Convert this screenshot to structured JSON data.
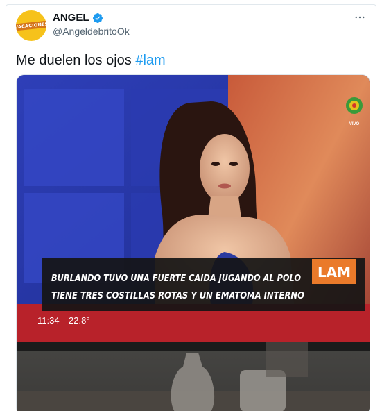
{
  "tweet": {
    "author": {
      "display_name": "ANGEL",
      "handle": "@AngeldebritoOk",
      "avatar_text": "VACACIONES"
    },
    "text_prefix": "Me duelen los ojos ",
    "hashtag": "#lam",
    "media": {
      "channel_logo_text": "VIVO",
      "show_logo": "LAM",
      "headline_line1": "BURLANDO TUVO UNA FUERTE CAIDA JUGANDO AL POLO",
      "headline_line2": "TIENE TRES COSTILLAS ROTAS Y UN EMATOMA INTERNO",
      "clock": "11:34",
      "temperature": "22.8°"
    }
  },
  "colors": {
    "accent": "#1d9bf0",
    "verified": "#1d9bf0",
    "avatar_bg": "#f6c21b"
  },
  "icons": {
    "verified": "verified-badge-icon",
    "more": "more-options-icon"
  }
}
